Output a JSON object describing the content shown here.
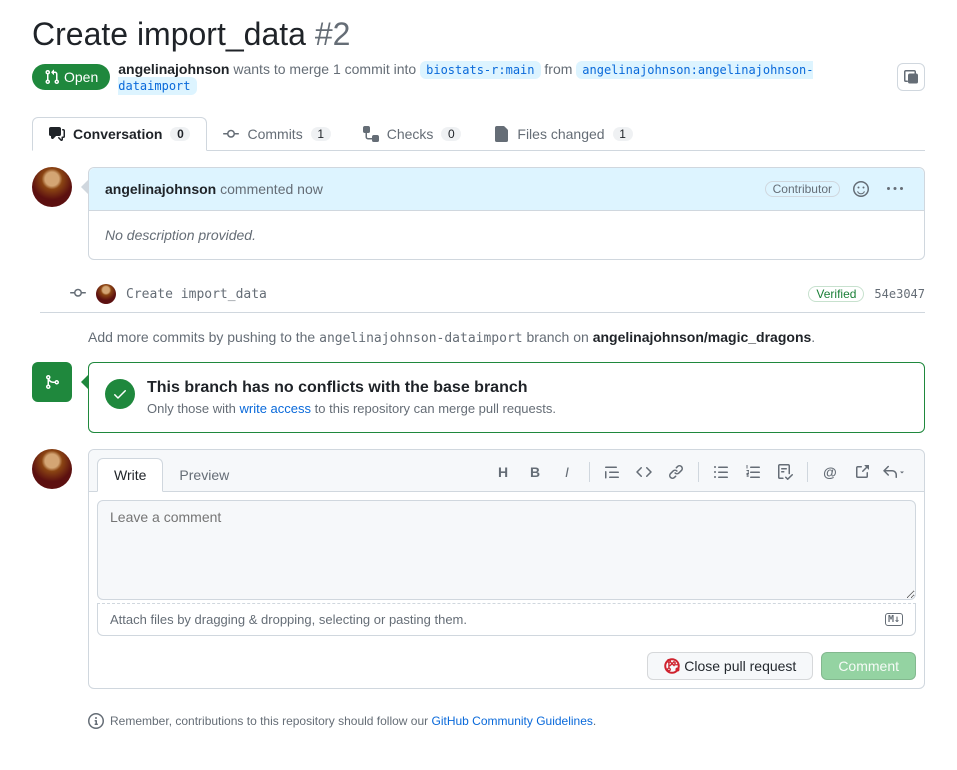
{
  "title": "Create import_data",
  "number": "#2",
  "state": "Open",
  "author": "angelinajohnson",
  "merge_desc_1": "wants to merge 1 commit into",
  "base_branch": "biostats-r:main",
  "merge_desc_2": "from",
  "head_branch": "angelinajohnson:angelinajohnson-dataimport",
  "tabs": [
    {
      "label": "Conversation",
      "count": "0"
    },
    {
      "label": "Commits",
      "count": "1"
    },
    {
      "label": "Checks",
      "count": "0"
    },
    {
      "label": "Files changed",
      "count": "1"
    }
  ],
  "comment": {
    "author": "angelinajohnson",
    "time": "commented now",
    "role": "Contributor",
    "body": "No description provided."
  },
  "commit": {
    "message": "Create import_data",
    "verified": "Verified",
    "sha": "54e3047"
  },
  "push_info": {
    "prefix": "Add more commits by pushing to the",
    "branch": "angelinajohnson-dataimport",
    "on": "branch on",
    "repo": "angelinajohnson/magic_dragons"
  },
  "merge": {
    "title": "This branch has no conflicts with the base branch",
    "desc_1": "Only those with",
    "link": "write access",
    "desc_2": "to this repository can merge pull requests."
  },
  "editor": {
    "write": "Write",
    "preview": "Preview",
    "placeholder": "Leave a comment",
    "attach": "Attach files by dragging & dropping, selecting or pasting them."
  },
  "buttons": {
    "close": "Close pull request",
    "comment": "Comment"
  },
  "footer": {
    "text": "Remember, contributions to this repository should follow our",
    "link": "GitHub Community Guidelines"
  }
}
